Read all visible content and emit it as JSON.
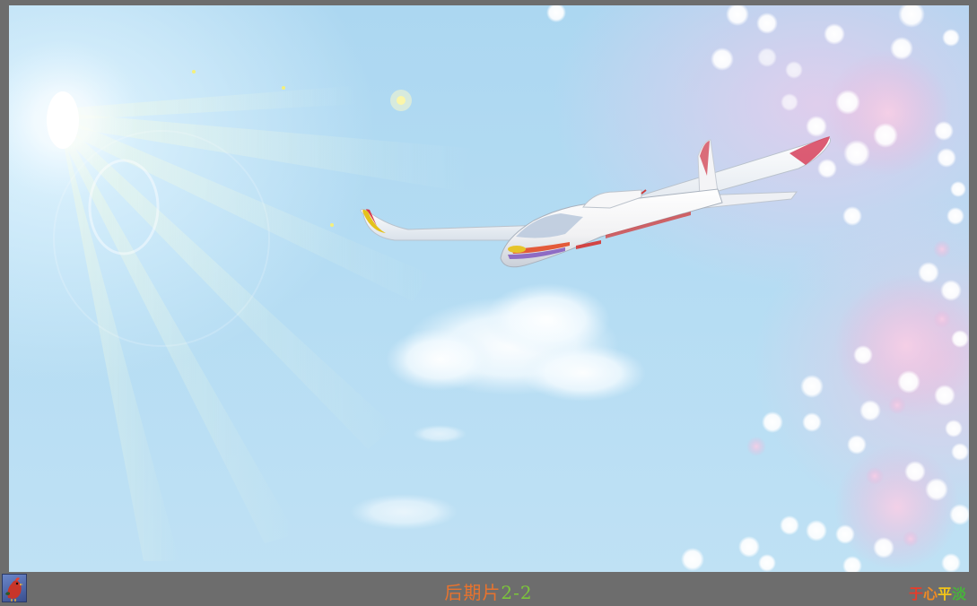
{
  "caption": {
    "main": "后期片",
    "number": "2-2"
  },
  "signature": {
    "c1": "于",
    "c2": "心",
    "c3": "平",
    "c4": "淡"
  },
  "colors": {
    "sky": "#b4dcf3",
    "frame": "#6d6d6d",
    "caption_main": "#e8732e",
    "caption_number": "#7cc63a"
  },
  "icons": {
    "avatar": "rooster-avatar-icon"
  }
}
